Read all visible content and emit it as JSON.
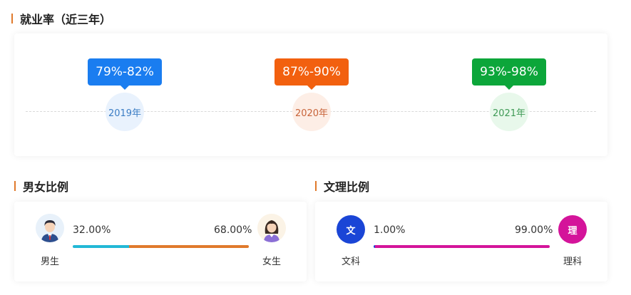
{
  "employment": {
    "title": "就业率（近三年）",
    "years": [
      {
        "year": "2019年",
        "rate": "79%-82%",
        "color": "#1a7df0",
        "circle_bg": "#e9f2fd",
        "text_color": "#3b7dc4"
      },
      {
        "year": "2020年",
        "rate": "87%-90%",
        "color": "#f2600f",
        "circle_bg": "#fdeee6",
        "text_color": "#c8643a"
      },
      {
        "year": "2021年",
        "rate": "93%-98%",
        "color": "#0ca63a",
        "circle_bg": "#e8f8eb",
        "text_color": "#3f9a56"
      }
    ]
  },
  "gender_ratio": {
    "title": "男女比例",
    "male_label": "男生",
    "female_label": "女生",
    "male_percent_text": "32.00%",
    "female_percent_text": "68.00%",
    "male_fraction": 0.32,
    "female_fraction": 0.68,
    "male_color": "#22b8d6",
    "female_color": "#e07a2c",
    "male_icon": "male-avatar-icon",
    "female_icon": "female-avatar-icon"
  },
  "subject_ratio": {
    "title": "文理比例",
    "arts_label": "文科",
    "science_label": "理科",
    "arts_icon_text": "文",
    "science_icon_text": "理",
    "arts_percent_text": "1.00%",
    "science_percent_text": "99.00%",
    "arts_fraction": 0.01,
    "science_fraction": 0.99,
    "arts_color": "#1a45d6",
    "science_color": "#d4149a"
  }
}
